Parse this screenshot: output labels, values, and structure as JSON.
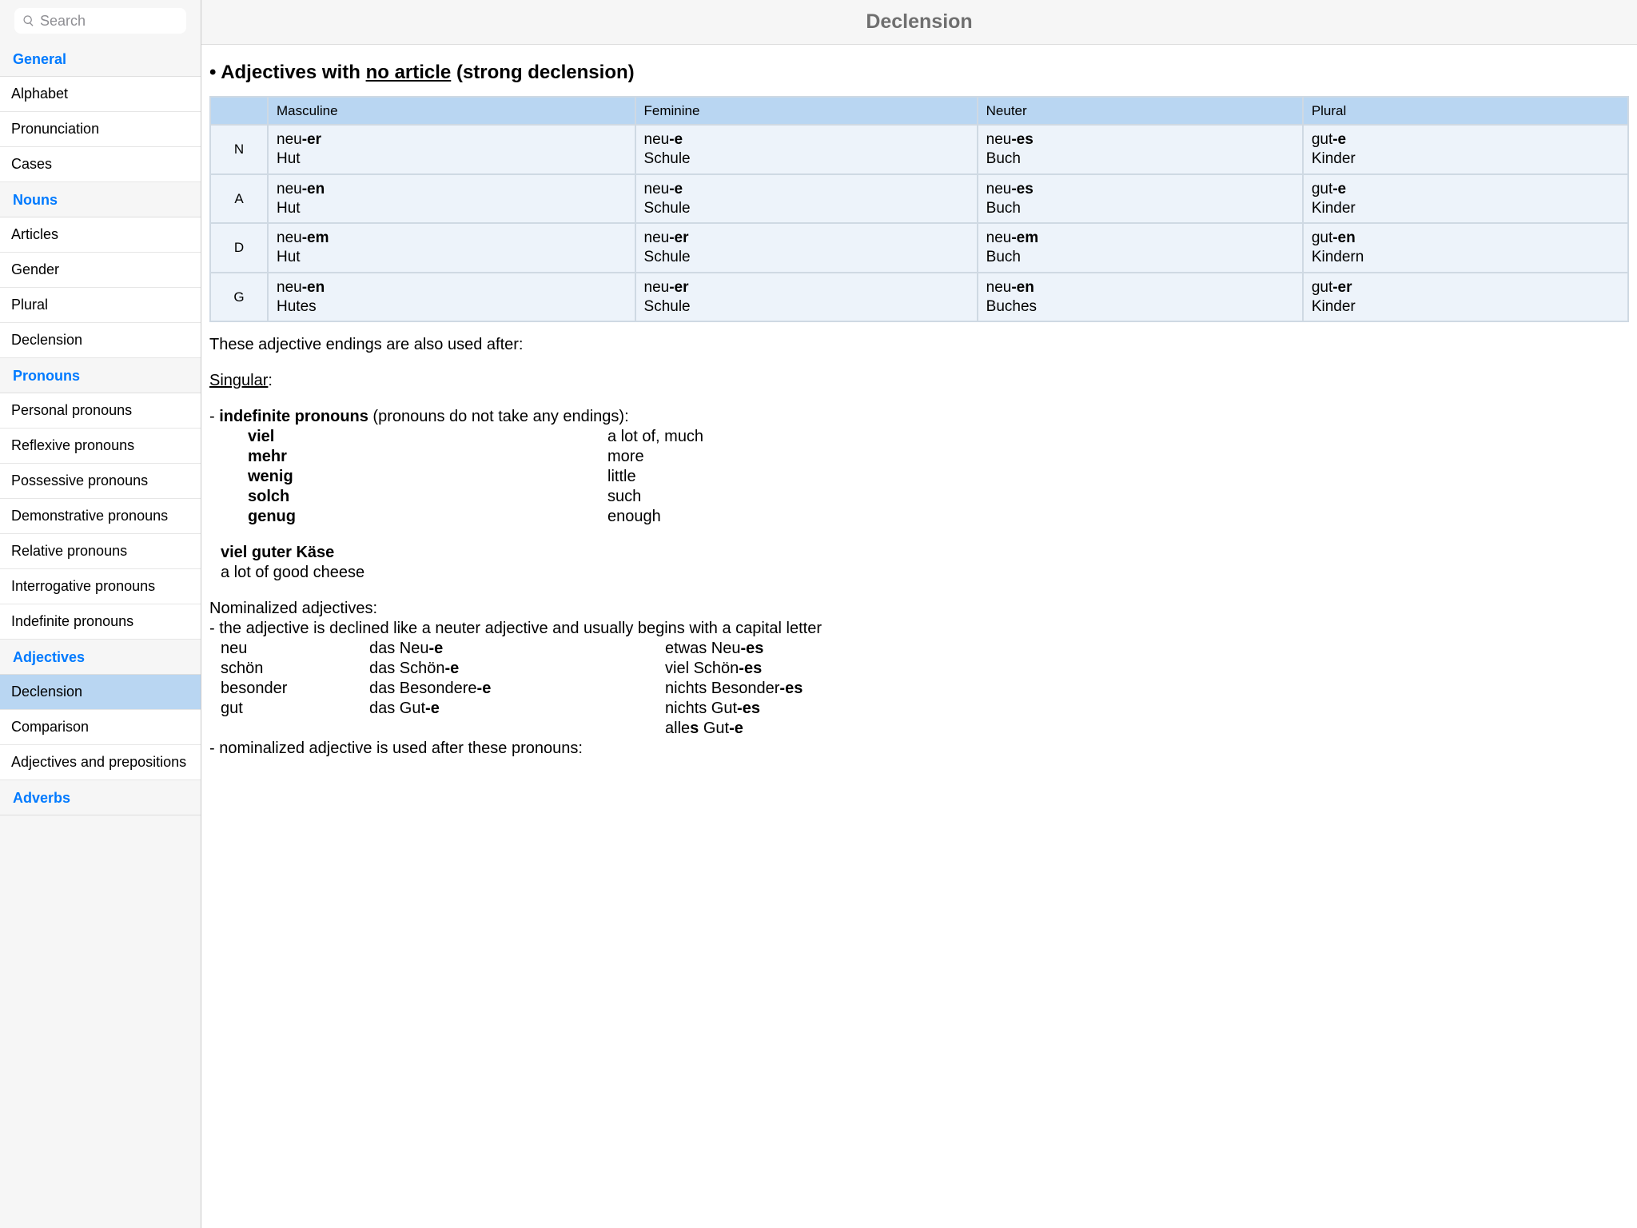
{
  "search": {
    "placeholder": "Search"
  },
  "title": "Declension",
  "sidebar": {
    "sections": [
      {
        "header": "General",
        "items": [
          "Alphabet",
          "Pronunciation",
          "Cases"
        ]
      },
      {
        "header": "Nouns",
        "items": [
          "Articles",
          "Gender",
          "Plural",
          "Declension"
        ]
      },
      {
        "header": "Pronouns",
        "items": [
          "Personal pronouns",
          "Reflexive pronouns",
          "Possessive pronouns",
          "Demonstrative pronouns",
          "Relative pronouns",
          "Interrogative pronouns",
          "Indefinite pronouns"
        ]
      },
      {
        "header": "Adjectives",
        "items": [
          "Declension",
          "Comparison",
          "Adjectives and prepositions"
        ],
        "selected": 0
      },
      {
        "header": "Adverbs",
        "items": []
      }
    ]
  },
  "heading": {
    "bullet": "•",
    "pre": "Adjectives with",
    "underlined": "no article",
    "post": "(strong declension)"
  },
  "table": {
    "columns": [
      "Masculine",
      "Feminine",
      "Neuter",
      "Plural"
    ],
    "rows": [
      {
        "case": "N",
        "cells": [
          {
            "stem": "neu",
            "suffix": "-er",
            "noun": "Hut"
          },
          {
            "stem": "neu",
            "suffix": "-e",
            "noun": "Schule"
          },
          {
            "stem": "neu",
            "suffix": "-es",
            "noun": "Buch"
          },
          {
            "stem": "gut",
            "suffix": "-e",
            "noun": "Kinder"
          }
        ]
      },
      {
        "case": "A",
        "cells": [
          {
            "stem": "neu",
            "suffix": "-en",
            "noun": "Hut"
          },
          {
            "stem": "neu",
            "suffix": "-e",
            "noun": "Schule"
          },
          {
            "stem": "neu",
            "suffix": "-es",
            "noun": "Buch"
          },
          {
            "stem": "gut",
            "suffix": "-e",
            "noun": "Kinder"
          }
        ]
      },
      {
        "case": "D",
        "cells": [
          {
            "stem": "neu",
            "suffix": "-em",
            "noun": "Hut"
          },
          {
            "stem": "neu",
            "suffix": "-er",
            "noun": "Schule"
          },
          {
            "stem": "neu",
            "suffix": "-em",
            "noun": "Buch"
          },
          {
            "stem": "gut",
            "suffix": "-en",
            "noun": "Kindern"
          }
        ]
      },
      {
        "case": "G",
        "cells": [
          {
            "stem": "neu",
            "suffix": "-en",
            "noun": "Hutes"
          },
          {
            "stem": "neu",
            "suffix": "-er",
            "noun": "Schule"
          },
          {
            "stem": "neu",
            "suffix": "-en",
            "noun": "Buches"
          },
          {
            "stem": "gut",
            "suffix": "-er",
            "noun": "Kinder"
          }
        ]
      }
    ]
  },
  "text": {
    "after_table": "These adjective endings are also used after:",
    "singular_label": "Singular",
    "indef_line_prefix": "- ",
    "indef_bold": "indefinite pronouns",
    "indef_paren": " (pronouns do not take any endings):",
    "indef_list": [
      {
        "de": "viel",
        "en": "a lot of, much"
      },
      {
        "de": "mehr",
        "en": "more"
      },
      {
        "de": "wenig",
        "en": "little"
      },
      {
        "de": "solch",
        "en": "such"
      },
      {
        "de": "genug",
        "en": "enough"
      }
    ],
    "example": {
      "de": "viel guter Käse",
      "en": "a lot of good cheese"
    },
    "nom_adj_title": "Nominalized adjectives:",
    "nom_adj_desc": "- the adjective is declined like a neuter adjective and usually begins with a capital letter",
    "nom_adj_rows": [
      {
        "c1": "neu",
        "c2_pre": "das Neu",
        "c2_suf": "-e",
        "c3_pre": "etwas Neu",
        "c3_suf": "-es"
      },
      {
        "c1": "schön",
        "c2_pre": "das Schön",
        "c2_suf": "-e",
        "c3_pre": "viel Schön",
        "c3_suf": "-es"
      },
      {
        "c1": "besonder",
        "c2_pre": "das Besondere",
        "c2_suf": "-e",
        "c3_pre": "nichts Besonder",
        "c3_suf": "-es"
      },
      {
        "c1": "gut",
        "c2_pre": "das Gut",
        "c2_suf": "-e",
        "c3_pre": "nichts Gut",
        "c3_suf": "-es"
      },
      {
        "c1": "",
        "c2_pre": "",
        "c2_suf": "",
        "c3_pre": "alle",
        "c3_mid_bold": "s",
        "c3_post": " Gut",
        "c3_suf": "-e"
      }
    ],
    "nom_adj_used_after": "- nominalized adjective is used after these pronouns:"
  }
}
